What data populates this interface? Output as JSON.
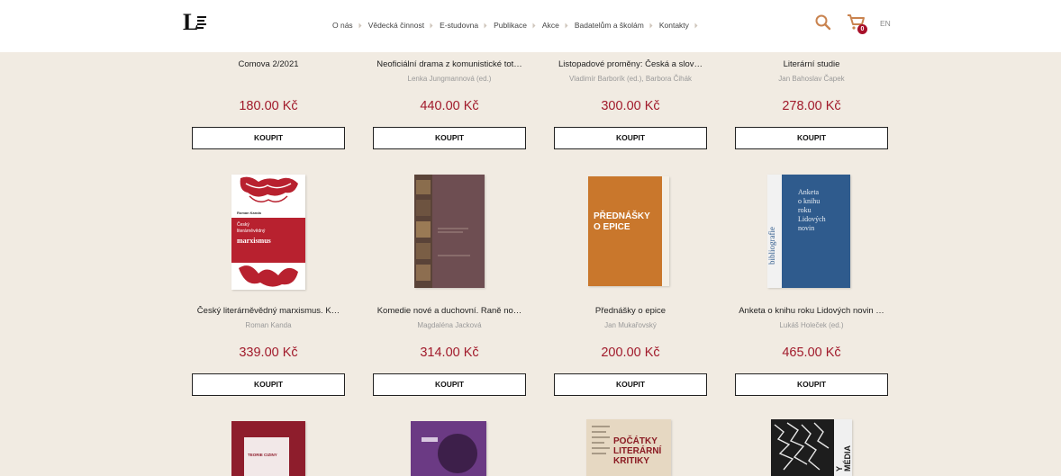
{
  "header": {
    "nav": [
      "O nás",
      "Vědecká činnost",
      "E-studovna",
      "Publikace",
      "Akce",
      "Badatelům a školám",
      "Kontakty"
    ],
    "cart_count": "0",
    "lang": "EN"
  },
  "products": [
    {
      "title": "Comova 2/2021",
      "author": "",
      "price": "180.00 Kč",
      "buy": "KOUPIT"
    },
    {
      "title": "Neoficiální drama z komunistické tot…",
      "author": "Lenka Jungmannová (ed.)",
      "price": "440.00 Kč",
      "buy": "KOUPIT"
    },
    {
      "title": "Listopadové proměny: Česká a slov…",
      "author": "Vladimír Barborík (ed.), Barbora Čihák",
      "price": "300.00 Kč",
      "buy": "KOUPIT"
    },
    {
      "title": "Literární studie",
      "author": "Jan Bahoslav Čapek",
      "price": "278.00 Kč",
      "buy": "KOUPIT"
    },
    {
      "title": "Český literárněvědný marxismus. K…",
      "author": "Roman Kanda",
      "price": "339.00 Kč",
      "buy": "KOUPIT"
    },
    {
      "title": "Komedie nové a duchovní. Raně no…",
      "author": "Magdaléna Jacková",
      "price": "314.00 Kč",
      "buy": "KOUPIT"
    },
    {
      "title": "Přednášky o epice",
      "author": "Jan Mukařovský",
      "price": "200.00 Kč",
      "buy": "KOUPIT"
    },
    {
      "title": "Anketa o knihu roku Lidových novin …",
      "author": "Lukáš Holeček (ed.)",
      "price": "465.00 Kč",
      "buy": "KOUPIT"
    }
  ],
  "covers": {
    "marxismus": {
      "author": "Roman Kanda",
      "l1": "Český",
      "l2": "literárněvědný",
      "l3": "marxismus"
    },
    "epice": {
      "l1": "PŘEDNÁŠKY",
      "l2": "O EPICE"
    },
    "anketa": {
      "l1": "Anketa",
      "l2": "o knihu",
      "l3": "roku",
      "l4": "Lidových",
      "l5": "novin",
      "side": "bibliografie"
    },
    "teorie": {
      "l1": "TEORIE CIZINY"
    },
    "pocatky": {
      "l1": "POČÁTKY",
      "l2": "LITERÁRNÍ",
      "l3": "KRITIKY"
    },
    "media": {
      "l1": "Y MÉDIA"
    }
  }
}
